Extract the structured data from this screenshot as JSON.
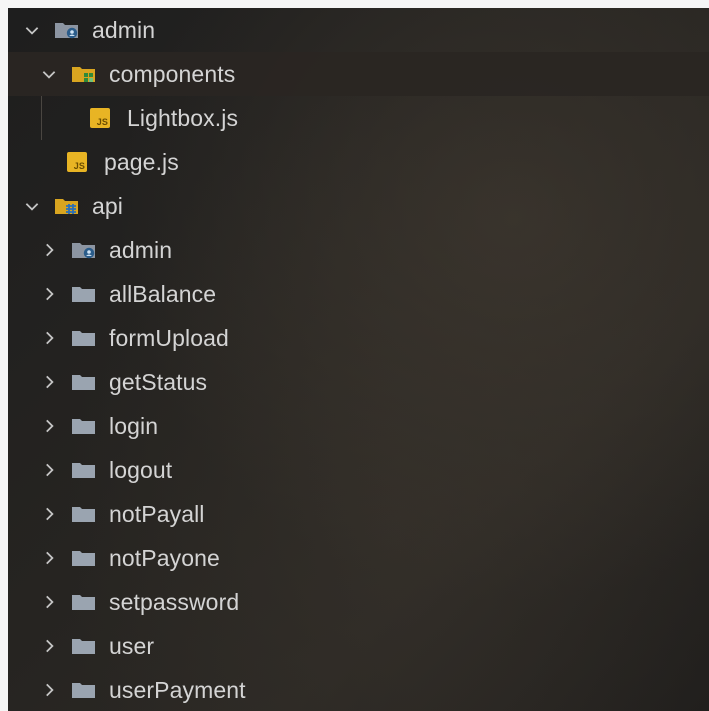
{
  "tree": {
    "admin_root": {
      "label": "admin",
      "icon": "admin-folder-icon"
    },
    "components": {
      "label": "components",
      "icon": "components-folder-icon"
    },
    "lightbox": {
      "label": "Lightbox.js",
      "icon": "js-file-icon"
    },
    "page": {
      "label": "page.js",
      "icon": "js-file-icon"
    },
    "api": {
      "label": "api",
      "icon": "api-folder-icon"
    },
    "api_children": [
      {
        "label": "admin",
        "icon": "admin-folder-icon"
      },
      {
        "label": "allBalance",
        "icon": "folder-icon"
      },
      {
        "label": "formUpload",
        "icon": "folder-icon"
      },
      {
        "label": "getStatus",
        "icon": "folder-icon"
      },
      {
        "label": "login",
        "icon": "folder-icon"
      },
      {
        "label": "logout",
        "icon": "folder-icon"
      },
      {
        "label": "notPayall",
        "icon": "folder-icon"
      },
      {
        "label": "notPayone",
        "icon": "folder-icon"
      },
      {
        "label": "setpassword",
        "icon": "folder-icon"
      },
      {
        "label": "user",
        "icon": "folder-icon"
      },
      {
        "label": "userPayment",
        "icon": "folder-icon"
      }
    ]
  },
  "colors": {
    "js_icon": "#e8b424",
    "folder_open": "#d9a520",
    "folder_closed": "#9aa4b0",
    "text": "#d4d4d4"
  }
}
